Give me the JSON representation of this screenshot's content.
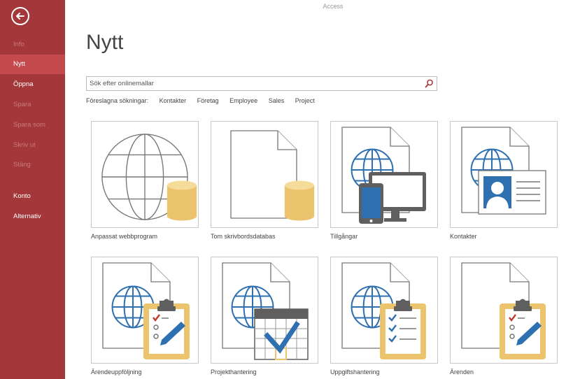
{
  "app": {
    "title": "Access"
  },
  "sidebar": {
    "back_icon": "back-arrow-icon",
    "items": [
      {
        "label": "Info",
        "state": "disabled"
      },
      {
        "label": "Nytt",
        "state": "selected"
      },
      {
        "label": "Öppna",
        "state": "enabled"
      },
      {
        "label": "Spara",
        "state": "disabled"
      },
      {
        "label": "Spara som",
        "state": "disabled"
      },
      {
        "label": "Skriv ut",
        "state": "disabled"
      },
      {
        "label": "Stäng",
        "state": "disabled"
      },
      {
        "label": "Konto",
        "state": "enabled"
      },
      {
        "label": "Alternativ",
        "state": "enabled"
      }
    ]
  },
  "main": {
    "heading": "Nytt",
    "search": {
      "placeholder": "Sök efter onlinemallar",
      "value": "",
      "icon": "search-icon"
    },
    "suggestions": {
      "label": "Föreslagna sökningar:",
      "items": [
        "Kontakter",
        "Företag",
        "Employee",
        "Sales",
        "Project"
      ]
    },
    "templates": [
      {
        "label": "Anpassat webbprogram",
        "icon": "web-app-globe-database-icon"
      },
      {
        "label": "Tom skrivbordsdatabas",
        "icon": "blank-document-database-icon"
      },
      {
        "label": "Tillgångar",
        "icon": "assets-devices-icon"
      },
      {
        "label": "Kontakter",
        "icon": "contacts-card-icon"
      },
      {
        "label": "Ärendeuppföljning",
        "icon": "issue-tracking-clipboard-icon"
      },
      {
        "label": "Projekthantering",
        "icon": "project-calendar-icon"
      },
      {
        "label": "Uppgiftshantering",
        "icon": "task-checklist-icon"
      },
      {
        "label": "Ärenden",
        "icon": "issues-clipboard-icon"
      }
    ]
  },
  "colors": {
    "sidebar_bg": "#a4373a",
    "sidebar_selected": "#c3494c",
    "database_gold": "#ecc46d",
    "globe_blue": "#2f70b0",
    "device_gray": "#5f5f5f"
  }
}
